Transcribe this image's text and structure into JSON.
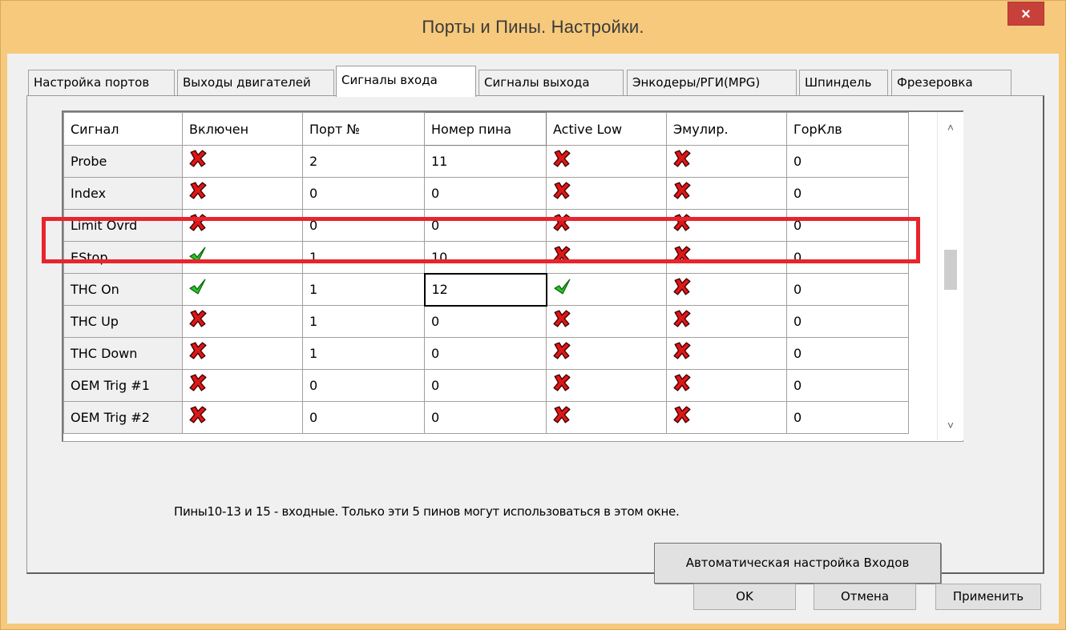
{
  "window": {
    "title": "Порты и Пины.  Настройки.",
    "close_label": "×"
  },
  "tabs": [
    {
      "label": "Настройка портов",
      "active": false
    },
    {
      "label": "Выходы двигателей",
      "active": false
    },
    {
      "label": "Сигналы входа",
      "active": true
    },
    {
      "label": "Сигналы выхода",
      "active": false
    },
    {
      "label": "Энкодеры/РГИ(MPG)",
      "active": false
    },
    {
      "label": "Шпиндель",
      "active": false
    },
    {
      "label": "Фрезеровка",
      "active": false
    }
  ],
  "grid": {
    "headers": [
      "Сигнал",
      "Включен",
      "Порт №",
      "Номер пина",
      "Active Low",
      "Эмулир.",
      "ГорКлв"
    ],
    "rows": [
      {
        "signal": "Probe",
        "enabled": false,
        "port": "2",
        "pin": "11",
        "active_low": false,
        "emulated": false,
        "hotkey": "0"
      },
      {
        "signal": "Index",
        "enabled": false,
        "port": "0",
        "pin": "0",
        "active_low": false,
        "emulated": false,
        "hotkey": "0"
      },
      {
        "signal": "Limit Ovrd",
        "enabled": false,
        "port": "0",
        "pin": "0",
        "active_low": false,
        "emulated": false,
        "hotkey": "0"
      },
      {
        "signal": "EStop",
        "enabled": true,
        "port": "1",
        "pin": "10",
        "active_low": false,
        "emulated": false,
        "hotkey": "0"
      },
      {
        "signal": "THC On",
        "enabled": true,
        "port": "1",
        "pin": "12",
        "active_low": true,
        "emulated": false,
        "hotkey": "0"
      },
      {
        "signal": "THC Up",
        "enabled": false,
        "port": "1",
        "pin": "0",
        "active_low": false,
        "emulated": false,
        "hotkey": "0"
      },
      {
        "signal": "THC Down",
        "enabled": false,
        "port": "1",
        "pin": "0",
        "active_low": false,
        "emulated": false,
        "hotkey": "0"
      },
      {
        "signal": "OEM Trig #1",
        "enabled": false,
        "port": "0",
        "pin": "0",
        "active_low": false,
        "emulated": false,
        "hotkey": "0"
      },
      {
        "signal": "OEM Trig #2",
        "enabled": false,
        "port": "0",
        "pin": "0",
        "active_low": false,
        "emulated": false,
        "hotkey": "0"
      }
    ],
    "scroll_up_glyph": "˄",
    "scroll_down_glyph": "˅"
  },
  "note": "Пины10-13 и 15 - входные. Только эти 5 пинов могут использоваться в этом окне.",
  "buttons": {
    "auto": "Автоматическая настройка Входов",
    "ok": "OK",
    "cancel": "Отмена",
    "apply": "Применить"
  },
  "colors": {
    "accent_highlight": "#e8242c",
    "check": "#2fc12f",
    "cross": "#e01616",
    "titlebar": "#f6c97c"
  },
  "icons": {
    "true": "green-check-icon",
    "false": "red-x-icon"
  }
}
